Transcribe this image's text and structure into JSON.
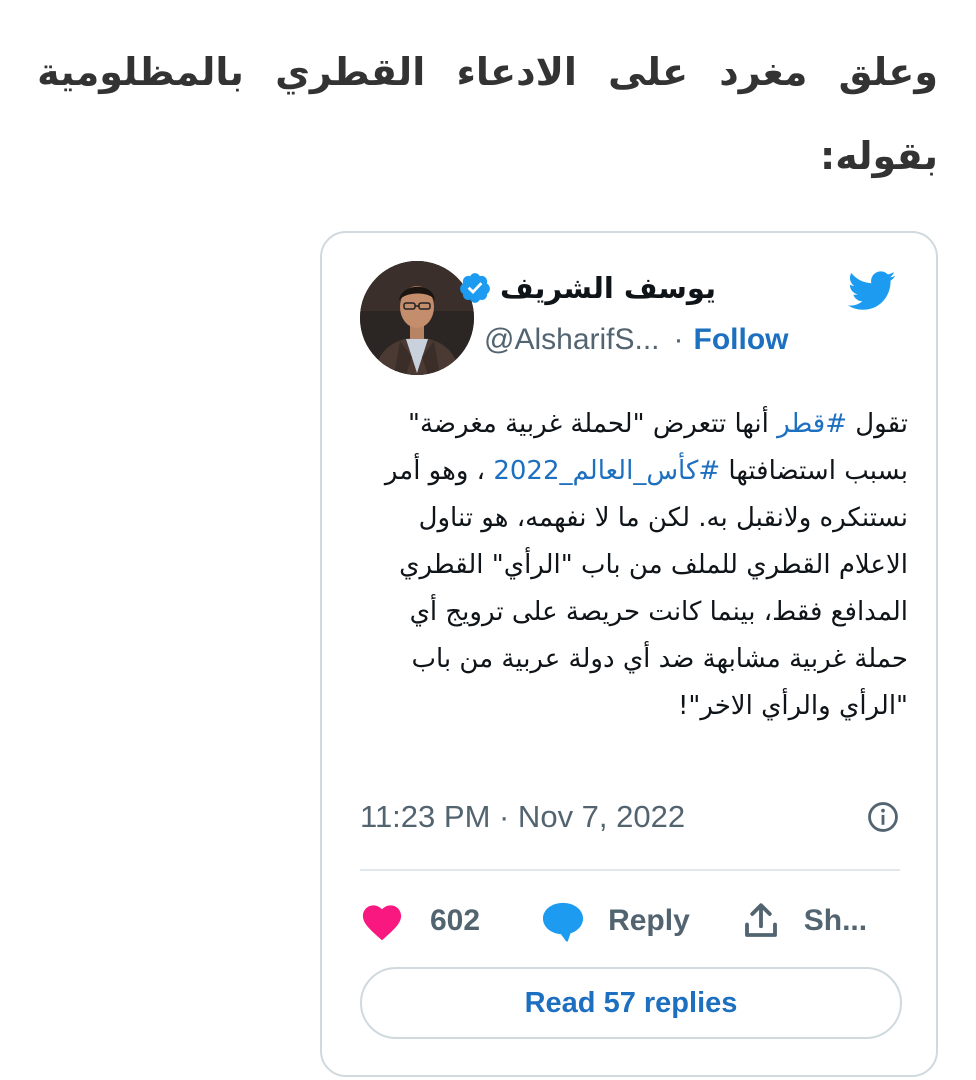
{
  "article": {
    "lead_text": "وعلق مغرد على الادعاء القطري بالمظلومية بقوله:"
  },
  "tweet": {
    "author_name": "يوسف الشريف",
    "handle": "@AlsharifS...",
    "separator": "·",
    "follow_label": "Follow",
    "text_intro": "تقول ",
    "hashtag_qatar": "#قطر",
    "text_mid": " أنها تتعرض \"لحملة غربية مغرضة\" بسبب استضافتها ",
    "hashtag_worldcup": "#كأس_العالم_2022",
    "text_rest": " ، وهو أمر نستنكره ولانقبل به. لكن ما لا نفهمه، هو تناول الاعلام القطري للملف من باب \"الرأي\" القطري المدافع فقط، بينما كانت حريصة على ترويج أي حملة غربية مشابهة ضد أي دولة عربية من باب \"الرأي والرأي الاخر\"!",
    "timestamp": "11:23 PM · Nov 7, 2022",
    "like_count": "602",
    "reply_label": "Reply",
    "share_label": "Sh...",
    "read_replies_label": "Read 57 replies"
  },
  "icons": {
    "brand": "twitter-bird-icon",
    "verified": "verified-badge-icon",
    "info": "info-icon",
    "like": "heart-icon",
    "reply": "speech-bubble-icon",
    "share": "share-upload-icon"
  },
  "colors": {
    "twitter_blue": "#1d9bf0",
    "link_blue": "#1d6fbf",
    "heart_pink": "#f91880",
    "muted_gray": "#536471",
    "border_gray": "#cfd9de"
  }
}
